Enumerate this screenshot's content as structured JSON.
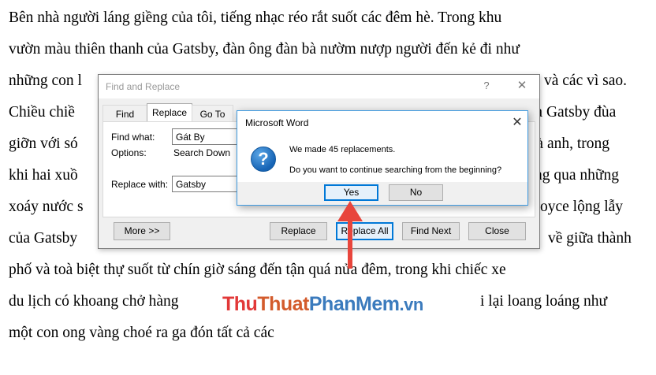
{
  "document": {
    "lines": [
      "Bên nhà người láng giềng của tôi, tiếng nhạc réo rắt suốt các đêm hè. Trong khu",
      "vườn màu thiên thanh của Gatsby, đàn ông đàn bà nườm nượp người đến kẻ đi như",
      "những con l",
      "Chiều chiề",
      "giỡn với só",
      "khi hai xuồ",
      "xoáy nước s",
      "của Gatsby",
      "phố và toà biệt thự suốt từ chín giờ sáng đến tận quá nửa đêm, trong khi chiếc xe",
      "du lịch có khoang chở hàng",
      "một con ong vàng choé ra ga đón tất cả các"
    ],
    "right_fragments": [
      "và các vì sao.",
      "ia Gatsby đùa",
      "ià anh, trong",
      "ng qua những",
      "oyce lộng lẫy",
      "về giữa thành",
      "i lại loang loáng như"
    ]
  },
  "find_replace": {
    "title": "Find and Replace",
    "help_glyph": "?",
    "close_glyph": "✕",
    "tabs": [
      "Find",
      "Replace",
      "Go To"
    ],
    "find_label": "Find what:",
    "find_value": "Gát By",
    "options_label": "Options:",
    "options_value": "Search Down",
    "replace_label": "Replace with:",
    "replace_value": "Gatsby",
    "buttons": {
      "more": "More >>",
      "replace": "Replace",
      "replace_all": "Replace All",
      "find_next": "Find Next",
      "close": "Close"
    }
  },
  "message_box": {
    "title": "Microsoft Word",
    "close_glyph": "✕",
    "icon": "question-icon",
    "icon_glyph": "?",
    "line1": "We made 45 replacements.",
    "line2": "Do you want to continue searching from the beginning?",
    "yes": "Yes",
    "no": "No"
  },
  "annotation": {
    "arrow_color": "#e8453c"
  },
  "watermark": {
    "part1": "Thu",
    "part2": "Thuat",
    "part3": "PhanMem",
    "part4": ".vn"
  },
  "colors": {
    "focus_border": "#0078d7",
    "accent_blue": "#1764b5"
  }
}
